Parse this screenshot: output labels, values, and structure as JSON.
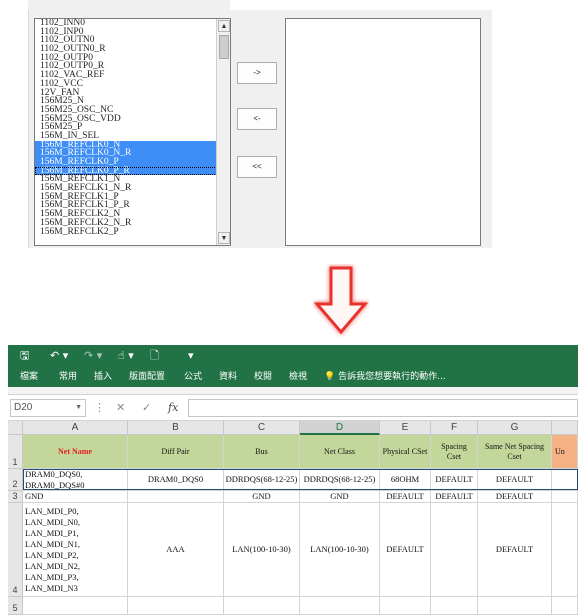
{
  "dialog": {
    "available_list": {
      "items": [
        {
          "label": "1102_INN0",
          "selected": false
        },
        {
          "label": "1102_INP0",
          "selected": false
        },
        {
          "label": "1102_OUTN0",
          "selected": false
        },
        {
          "label": "1102_OUTN0_R",
          "selected": false
        },
        {
          "label": "1102_OUTP0",
          "selected": false
        },
        {
          "label": "1102_OUTP0_R",
          "selected": false
        },
        {
          "label": "1102_VAC_REF",
          "selected": false
        },
        {
          "label": "1102_VCC",
          "selected": false
        },
        {
          "label": "12V_FAN",
          "selected": false
        },
        {
          "label": "156M25_N",
          "selected": false
        },
        {
          "label": "156M25_OSC_NC",
          "selected": false
        },
        {
          "label": "156M25_OSC_VDD",
          "selected": false
        },
        {
          "label": "156M25_P",
          "selected": false
        },
        {
          "label": "156M_IN_SEL",
          "selected": false
        },
        {
          "label": "156M_REFCLK0_N",
          "selected": true
        },
        {
          "label": "156M_REFCLK0_N_R",
          "selected": true
        },
        {
          "label": "156M_REFCLK0_P",
          "selected": true
        },
        {
          "label": "156M_REFCLK0_P_R",
          "selected": true,
          "focused": true
        },
        {
          "label": "156M_REFCLK1_N",
          "selected": false
        },
        {
          "label": "156M_REFCLK1_N_R",
          "selected": false
        },
        {
          "label": "156M_REFCLK1_P",
          "selected": false
        },
        {
          "label": "156M_REFCLK1_P_R",
          "selected": false
        },
        {
          "label": "156M_REFCLK2_N",
          "selected": false
        },
        {
          "label": "156M_REFCLK2_N_R",
          "selected": false
        },
        {
          "label": "156M_REFCLK2_P",
          "selected": false
        }
      ]
    },
    "buttons": {
      "add": "->",
      "remove": "<-",
      "remove_all": "<<"
    },
    "scroll": {
      "up": "▲",
      "down": "▼"
    },
    "selection_color": "#3f8ef5"
  },
  "arrow": {
    "icon": "down-arrow-icon",
    "color": "#e8322f"
  },
  "excel": {
    "brand_color": "#217346",
    "qat": {
      "save": "🖫",
      "undo": "↶ ▾",
      "redo": "↷ ▾",
      "touch": "☝ ▾",
      "new": "🗋",
      "customize": "▾"
    },
    "ribbon_tabs": [
      "檔案",
      "常用",
      "插入",
      "版面配置",
      "公式",
      "資料",
      "校閱",
      "檢視"
    ],
    "tell_me": "告訴我您想要執行的動作...",
    "name_box": "D20",
    "formula_bar": {
      "cancel": "✕",
      "enter": "✓",
      "fx": "fx",
      "value": ""
    },
    "columns": [
      "A",
      "B",
      "C",
      "D",
      "E",
      "F",
      "G",
      "H"
    ],
    "rows": [
      "1",
      "2",
      "3",
      "4",
      "5"
    ],
    "header_row": {
      "a": "Net Name",
      "b": "Diff Pair",
      "c": "Bus",
      "d": "Net Class",
      "e": "Physical CSet",
      "f": "Spacing\nCset",
      "g": "Same Net Spacing\nCset",
      "h": "Un"
    },
    "row2": {
      "a": "DRAM0_DQS0,\nDRAM0_DQS#0",
      "b": "DRAM0_DQS0",
      "c": "DDRDQS(68-12-25)",
      "d": "DDRDQS(68-12-25)",
      "e": "68OHM",
      "f": "DEFAULT",
      "g": "DEFAULT"
    },
    "row3": {
      "a": "GND",
      "b": "",
      "c": "GND",
      "d": "GND",
      "e": "DEFAULT",
      "f": "DEFAULT",
      "g": "DEFAULT"
    },
    "row4": {
      "a": "LAN_MDI_P0,\nLAN_MDI_N0,\nLAN_MDI_P1,\nLAN_MDI_N1,\nLAN_MDI_P2,\nLAN_MDI_N2,\nLAN_MDI_P3,\nLAN_MDI_N3",
      "b": "AAA",
      "c": "LAN(100-10-30)",
      "d": "LAN(100-10-30)",
      "e": "DEFAULT",
      "f": "",
      "g": "DEFAULT"
    },
    "header_colors": {
      "green": "#c4d79b",
      "orange": "#f4b183",
      "red_text": "#e02020"
    }
  }
}
